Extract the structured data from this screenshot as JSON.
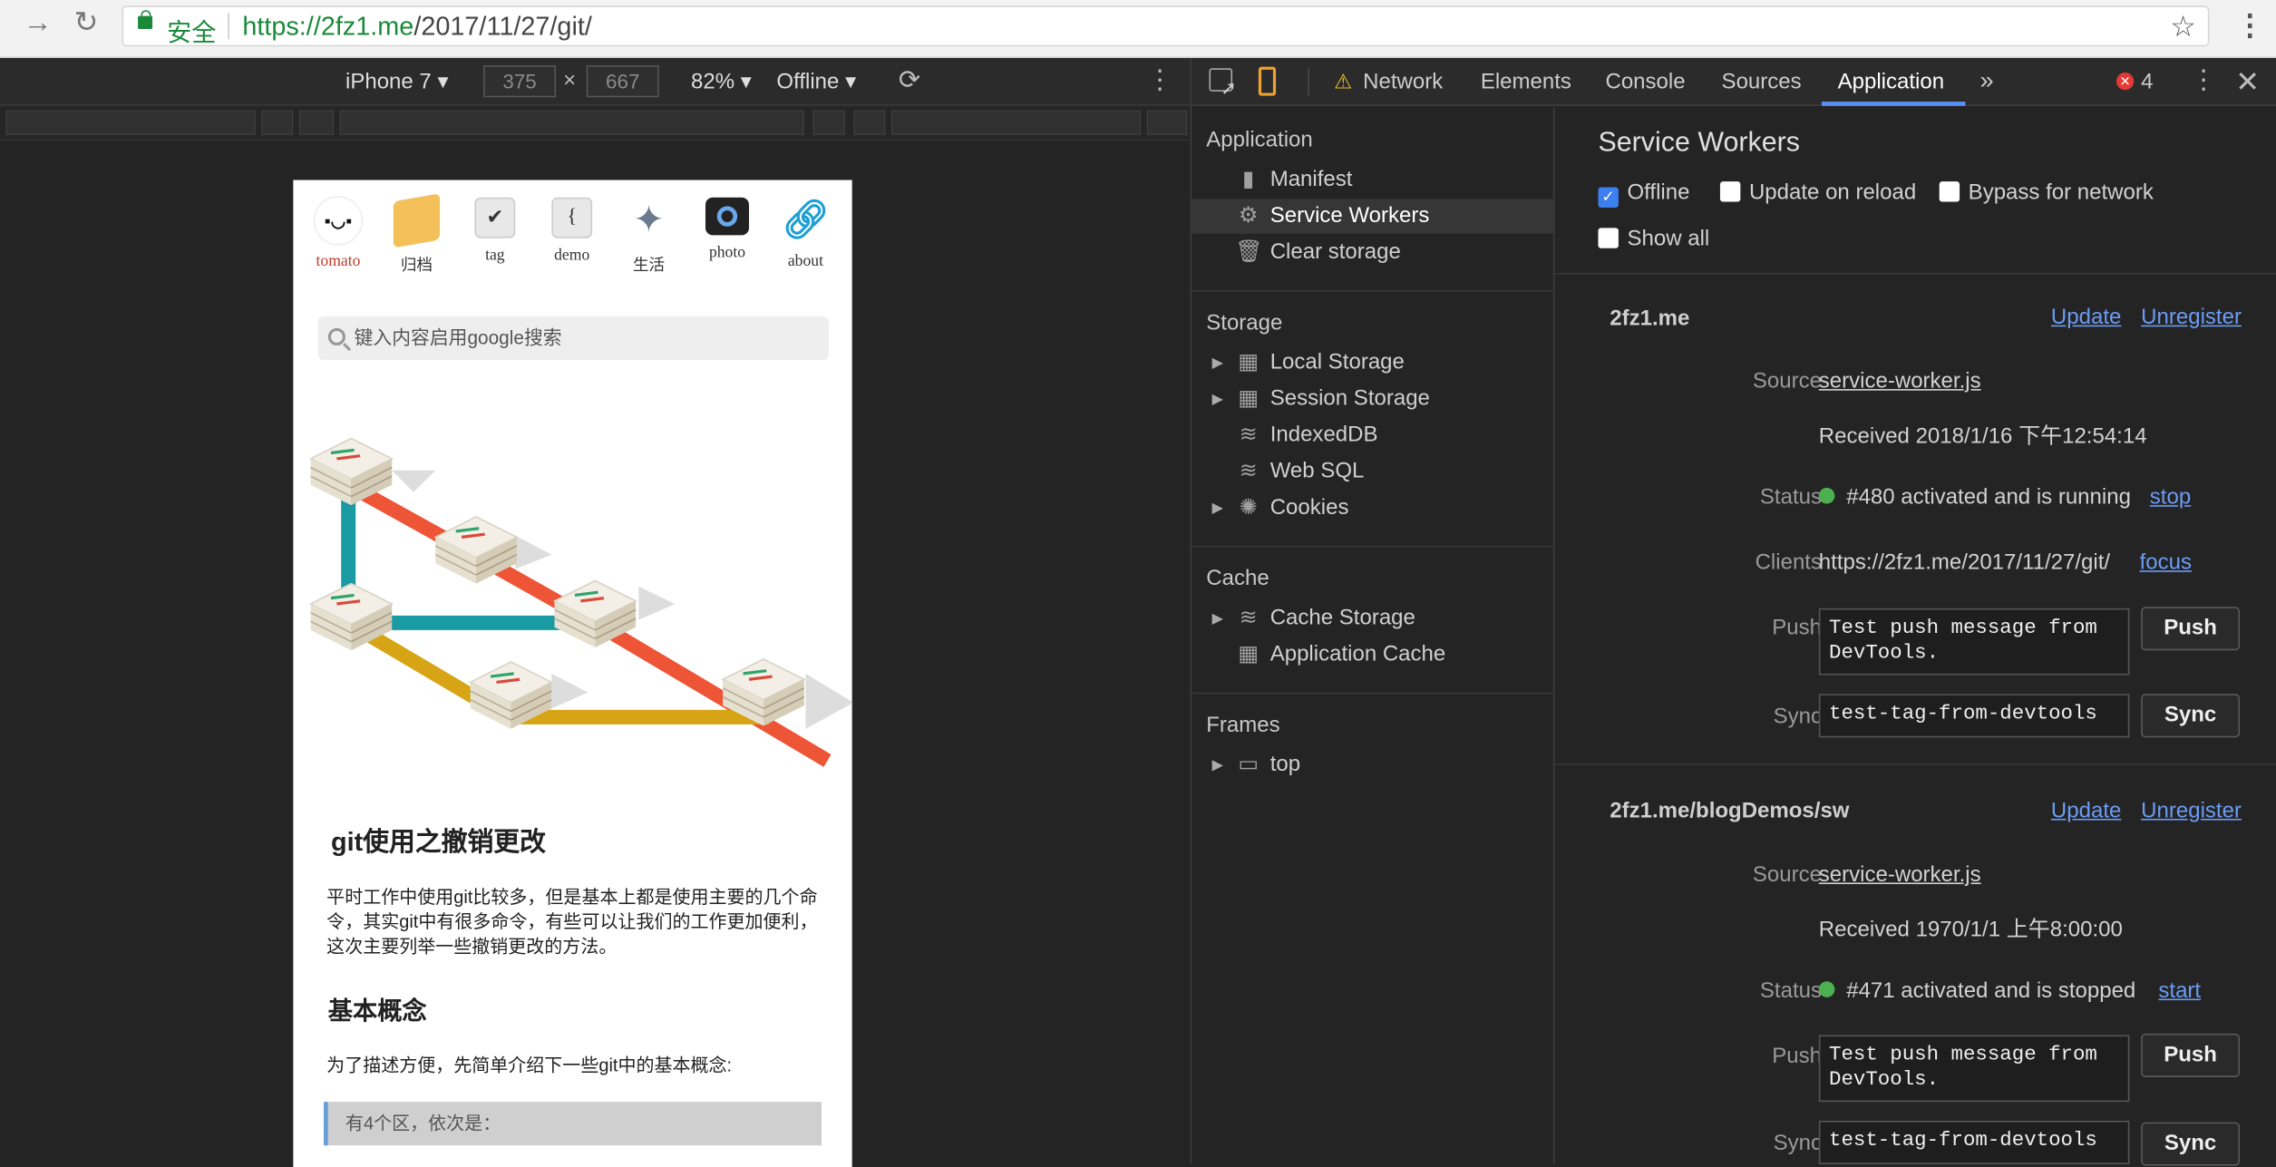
{
  "browser": {
    "secure_label": "安全",
    "url_host": "https://2fz1.me",
    "url_path": "/2017/11/27/git/"
  },
  "emulation": {
    "device": "iPhone 7",
    "width": "375",
    "times": "×",
    "height": "667",
    "zoom": "82%",
    "network": "Offline"
  },
  "page": {
    "nav": [
      {
        "label": "tomato"
      },
      {
        "label": "归档"
      },
      {
        "label": "tag"
      },
      {
        "label": "demo"
      },
      {
        "label": "生活"
      },
      {
        "label": "photo"
      },
      {
        "label": "about"
      }
    ],
    "search_placeholder": "键入内容启用google搜索",
    "title": "git使用之撤销更改",
    "intro": "平时工作中使用git比较多，但是基本上都是使用主要的几个命令，其实git中有很多命令，有些可以让我们的工作更加便利，这次主要列举一些撤销更改的方法。",
    "h2": "基本概念",
    "para2": "为了描述方便，先简单介绍下一些git中的基本概念:",
    "quote": "有4个区，依次是："
  },
  "devtools": {
    "tabs": [
      "Network",
      "Elements",
      "Console",
      "Sources",
      "Application"
    ],
    "active_tab": "Application",
    "more": "»",
    "error_count": "4",
    "sidebar": {
      "application_header": "Application",
      "application_items": [
        "Manifest",
        "Service Workers",
        "Clear storage"
      ],
      "storage_header": "Storage",
      "storage_items": [
        "Local Storage",
        "Session Storage",
        "IndexedDB",
        "Web SQL",
        "Cookies"
      ],
      "cache_header": "Cache",
      "cache_items": [
        "Cache Storage",
        "Application Cache"
      ],
      "frames_header": "Frames",
      "frames_items": [
        "top"
      ]
    },
    "sw": {
      "title": "Service Workers",
      "offline": "Offline",
      "update_on_reload": "Update on reload",
      "bypass": "Bypass for network",
      "show_all": "Show all",
      "labels": {
        "source": "Source",
        "status": "Status",
        "clients": "Clients",
        "push": "Push",
        "sync": "Sync"
      },
      "update": "Update",
      "unregister": "Unregister",
      "push_btn": "Push",
      "sync_btn": "Sync",
      "workers": [
        {
          "scope": "2fz1.me",
          "source": "service-worker.js",
          "received": "Received 2018/1/16 下午12:54:14",
          "status": "#480 activated and is running",
          "action": "stop",
          "clients": "https://2fz1.me/2017/11/27/git/",
          "focus": "focus",
          "push": "Test push message from DevTools.",
          "sync": "test-tag-from-devtools"
        },
        {
          "scope": "2fz1.me/blogDemos/sw",
          "source": "service-worker.js",
          "received": "Received 1970/1/1 上午8:00:00",
          "status": "#471 activated and is stopped",
          "action": "start",
          "push": "Test push message from DevTools.",
          "sync": "test-tag-from-devtools"
        }
      ]
    }
  }
}
